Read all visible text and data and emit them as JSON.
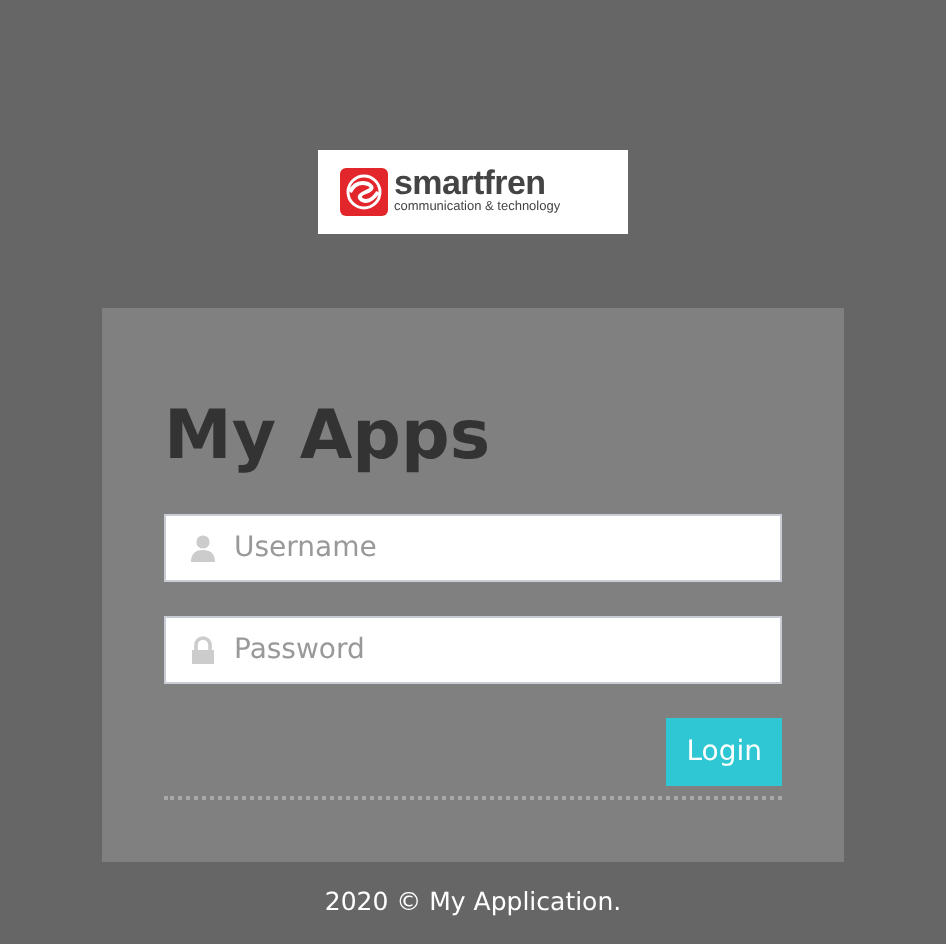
{
  "logo": {
    "name": "smartfren",
    "tagline": "communication & technology"
  },
  "login_card": {
    "title": "My Apps",
    "fields": [
      {
        "kind": "user",
        "placeholder": "Username"
      },
      {
        "kind": "password",
        "placeholder": "Password"
      }
    ],
    "button": "Login"
  },
  "footer": "2020 © My Application."
}
